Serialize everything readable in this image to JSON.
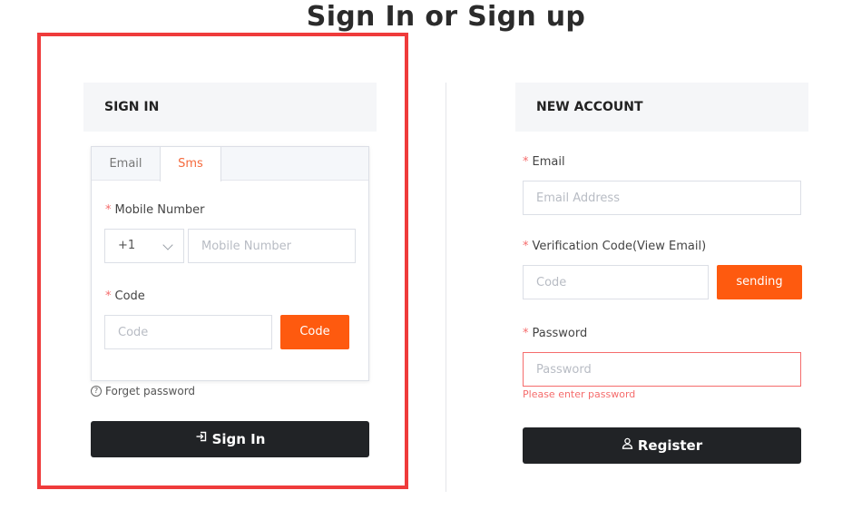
{
  "page": {
    "title": "Sign In or Sign up"
  },
  "signin": {
    "header": "SIGN IN",
    "tabs": [
      {
        "label": "Email",
        "active": false
      },
      {
        "label": "Sms",
        "active": true
      }
    ],
    "mobile": {
      "required_mark": "*",
      "label": "Mobile Number",
      "country_code": "+1",
      "placeholder": "Mobile Number",
      "value": ""
    },
    "code": {
      "required_mark": "*",
      "label": "Code",
      "placeholder": "Code",
      "value": "",
      "button_label": "Code"
    },
    "forget_label": "Forget password",
    "submit_label": "Sign In"
  },
  "register": {
    "header": "NEW ACCOUNT",
    "email": {
      "required_mark": "*",
      "label": "Email",
      "placeholder": "Email Address",
      "value": ""
    },
    "verification": {
      "required_mark": "*",
      "label": "Verification Code(View Email)",
      "placeholder": "Code",
      "value": "",
      "button_label": "sending"
    },
    "password": {
      "required_mark": "*",
      "label": "Password",
      "placeholder": "Password",
      "value": "",
      "error": "Please enter password"
    },
    "submit_label": "Register"
  },
  "colors": {
    "accent": "#fe5a0f",
    "dark_button": "#212326",
    "error": "#f56c6c",
    "highlight_frame": "#ef3b3b"
  },
  "icons": {
    "signin_button": "login-icon",
    "register_button": "user-icon",
    "forget": "question-circle-icon",
    "country_dropdown": "chevron-down-icon"
  }
}
